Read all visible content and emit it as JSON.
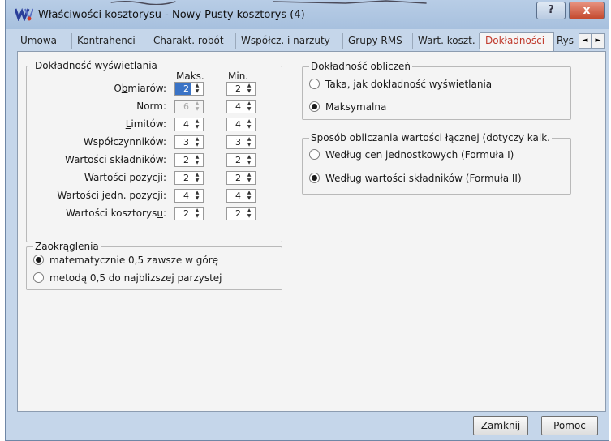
{
  "window": {
    "title": "Właściwości kosztorysu - Nowy  Pusty kosztorys (4)",
    "help_label": "?",
    "close_label": "x"
  },
  "tabs": [
    {
      "label": "Umowa"
    },
    {
      "label": "Kontrahenci"
    },
    {
      "label": "Charakt. robót"
    },
    {
      "label": "Współcz. i narzuty"
    },
    {
      "label": "Grupy RMS"
    },
    {
      "label": "Wart. koszt."
    },
    {
      "label": "Dokładności",
      "active": true
    },
    {
      "label": "Rys"
    }
  ],
  "tab_nav": {
    "prev": "◄",
    "next": "►"
  },
  "display_precision": {
    "title": "Dokładność wyświetlania",
    "col_max": "Maks.",
    "col_min": "Min.",
    "rows": [
      {
        "label_pre": "O",
        "label_ul": "b",
        "label_post": "miarów:",
        "max": "2",
        "min": "2"
      },
      {
        "label_pre": "Norm:",
        "label_ul": "",
        "label_post": "",
        "max": "6",
        "min": "4"
      },
      {
        "label_pre": "",
        "label_ul": "L",
        "label_post": "imitów:",
        "max": "4",
        "min": "4"
      },
      {
        "label_pre": "Współczynników:",
        "label_ul": "",
        "label_post": "",
        "max": "3",
        "min": "3"
      },
      {
        "label_pre": "Wartości składników:",
        "label_ul": "",
        "label_post": "",
        "max": "2",
        "min": "2"
      },
      {
        "label_pre": "Wartości ",
        "label_ul": "p",
        "label_post": "ozycji:",
        "max": "2",
        "min": "2"
      },
      {
        "label_pre": "Wartości jedn. pozycji:",
        "label_ul": "",
        "label_post": "",
        "max": "4",
        "min": "4"
      },
      {
        "label_pre": "Wartości kosztorys",
        "label_ul": "u",
        "label_post": ":",
        "max": "2",
        "min": "2"
      }
    ]
  },
  "rounding": {
    "title": "Zaokrąglenia",
    "options": [
      {
        "label": "matematycznie 0,5 zawsze w górę",
        "selected": true
      },
      {
        "label": "metodą 0,5 do najblizszej parzystej",
        "selected": false
      }
    ]
  },
  "calc_precision": {
    "title": "Dokładność obliczeń",
    "options": [
      {
        "label": "Taka, jak dokładność wyświetlania",
        "selected": false
      },
      {
        "label": "Maksymalna",
        "selected": true
      }
    ]
  },
  "total_method": {
    "title": "Sposób obliczania wartości łącznej (dotyczy kalk.",
    "options": [
      {
        "label": "Według cen jednostkowych (Formuła I)",
        "selected": false
      },
      {
        "label": "Według wartości składników (Formuła II)",
        "selected": true
      }
    ]
  },
  "buttons": {
    "close_ul": "Z",
    "close_rest": "amknij",
    "help_ul": "P",
    "help_rest": "omoc"
  }
}
